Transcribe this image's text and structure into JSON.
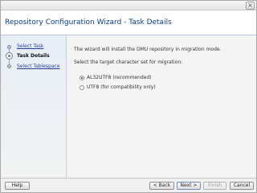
{
  "window": {
    "close_icon": "close-icon"
  },
  "header": {
    "title": "Repository Configuration Wizard - Task Details"
  },
  "sidebar": {
    "steps": [
      {
        "label": "Select Task",
        "state": "link"
      },
      {
        "label": "Task Details",
        "state": "active"
      },
      {
        "label": "Select Tablespace",
        "state": "link"
      }
    ]
  },
  "content": {
    "intro": "The wizard will install the DMU repository in migration mode.",
    "prompt": "Select the target character set for migration:",
    "options": [
      {
        "label": "AL32UTF8 (recommended)",
        "checked": true
      },
      {
        "label": "UTF8 (for compatibility only)",
        "checked": false
      }
    ]
  },
  "footer": {
    "help": "Help",
    "back": "< Back",
    "next": "Next >",
    "finish": "Finish",
    "cancel": "Cancel"
  },
  "colors": {
    "title_text": "#0b3f83",
    "link_text": "#263f95"
  }
}
